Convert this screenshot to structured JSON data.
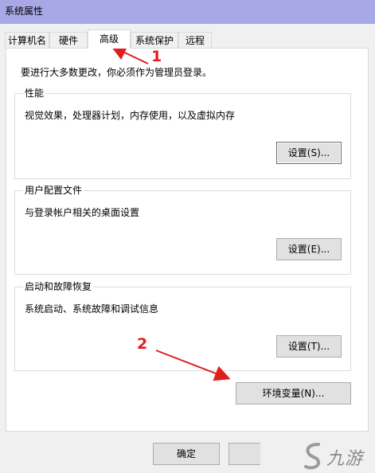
{
  "window": {
    "title": "系统属性"
  },
  "tabs": [
    {
      "label": "计算机名",
      "active": false
    },
    {
      "label": "硬件",
      "active": false
    },
    {
      "label": "高级",
      "active": true
    },
    {
      "label": "系统保护",
      "active": false
    },
    {
      "label": "远程",
      "active": false
    }
  ],
  "notice": "要进行大多数更改，你必须作为管理员登录。",
  "performance": {
    "title": "性能",
    "description": "视觉效果，处理器计划，内存使用，以及虚拟内存",
    "button": "设置(S)..."
  },
  "user_profiles": {
    "title": "用户配置文件",
    "description": "与登录帐户相关的桌面设置",
    "button": "设置(E)..."
  },
  "startup_recovery": {
    "title": "启动和故障恢复",
    "description": "系统启动、系统故障和调试信息",
    "button": "设置(T)..."
  },
  "env_button": "环境变量(N)...",
  "footer": {
    "ok": "确定"
  },
  "annotations": {
    "step1": "1",
    "step2": "2",
    "color": "#e01e1e"
  },
  "watermark": {
    "text": "九游"
  }
}
